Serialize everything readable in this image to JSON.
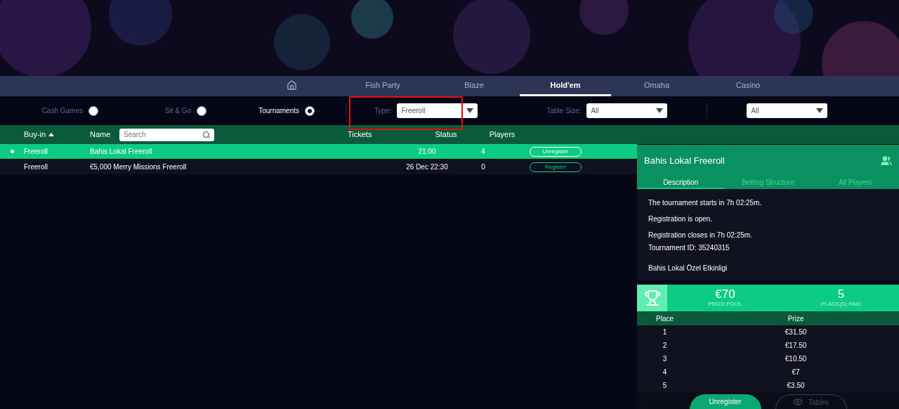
{
  "nav": {
    "tabs": [
      {
        "kind": "home",
        "selected": false
      },
      {
        "label": "Fish Party",
        "selected": false
      },
      {
        "label": "Blaze",
        "selected": false
      },
      {
        "label": "Hold'em",
        "selected": true
      },
      {
        "label": "Omaha",
        "selected": false
      },
      {
        "label": "Casino",
        "selected": false
      }
    ]
  },
  "modes": [
    {
      "label": "Cash Games",
      "selected": false
    },
    {
      "label": "Sit & Go",
      "selected": false
    },
    {
      "label": "Tournaments",
      "selected": true
    }
  ],
  "filters": [
    {
      "label": "Type:",
      "value": "Freeroll",
      "highlighted": true
    },
    {
      "label": "Table Size:",
      "value": "All",
      "highlighted": false
    },
    {
      "value": "All",
      "highlighted": false
    }
  ],
  "table": {
    "columns": [
      "Buy-in",
      "Name",
      "Tickets",
      "Status",
      "Players"
    ],
    "search_placeholder": "Search",
    "rows": [
      {
        "selected": true,
        "registered": true,
        "buy_in": "Freeroll",
        "name": "Bahis Lokal Freeroll",
        "status": "21:00",
        "players": "4",
        "action": "Unregister"
      },
      {
        "selected": false,
        "registered": false,
        "buy_in": "Freeroll",
        "name": "€5,000 Merry Missions Freeroll",
        "status": "26 Dec 22:30",
        "players": "0",
        "action": "Register"
      }
    ]
  },
  "details": {
    "title": "Bahis Lokal Freeroll",
    "tabs": [
      {
        "label": "Description",
        "selected": true
      },
      {
        "label": "Betting Structure",
        "selected": false
      },
      {
        "label": "All Players",
        "selected": false
      }
    ],
    "lines": [
      "The tournament starts in 7h 02:25m.",
      "Registration is open.",
      "Registration closes in 7h 02:25m.",
      "Tournament ID: 35240315",
      "Bahis Lokal Özel Etkinligi"
    ],
    "prize_pool": {
      "value": "€70",
      "label": "PRIZE POOL"
    },
    "places_paid": {
      "value": "5",
      "label": "PLACE(S) PAID"
    },
    "prize_columns": [
      "Place",
      "Prize"
    ],
    "prizes": [
      {
        "place": "1",
        "prize": "€31.50"
      },
      {
        "place": "2",
        "prize": "€17.50"
      },
      {
        "place": "3",
        "prize": "€10.50"
      },
      {
        "place": "4",
        "prize": "€7"
      },
      {
        "place": "5",
        "prize": "€3.50"
      }
    ],
    "buttons": [
      {
        "label": "Unregister",
        "kind": "primary"
      },
      {
        "label": "Tables",
        "kind": "disabled"
      }
    ]
  }
}
